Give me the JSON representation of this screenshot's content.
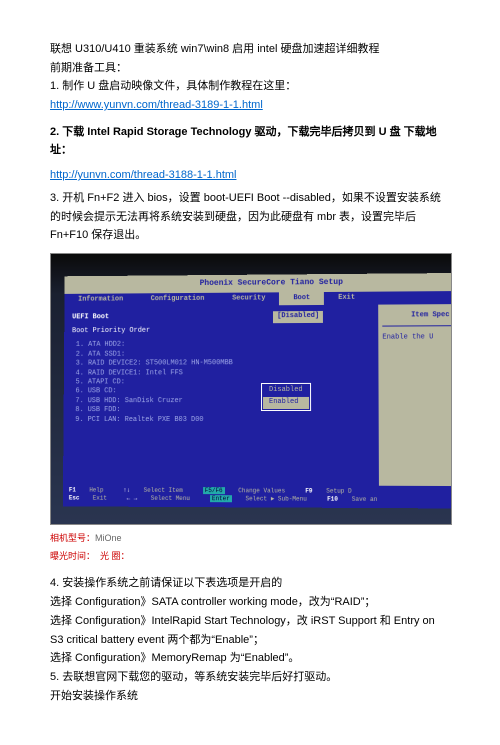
{
  "title": "联想 U310/U410 重装系统 win7\\win8 启用 intel 硬盘加速超详细教程",
  "prep_heading": "前期准备工具：",
  "step1": "1. 制作 U 盘启动映像文件，具体制作教程在这里：",
  "link1": "http://www.yunvn.com/thread-3189-1-1.html",
  "step2": "2. 下载 Intel Rapid Storage Technology  驱动，下载完毕后拷贝到 U 盘  下载地址：",
  "link2": "http://yunvn.com/thread-3188-1-1.html",
  "step3": "3. 开机 Fn+F2 进入 bios，设置 boot-UEFI Boot --disabled，如果不设置安装系统的时候会提示无法再将系统安装到硬盘，因为此硬盘有 mbr 表，设置完毕后 Fn+F10 保存退出。",
  "bios": {
    "header": "Phoenix SecureCore Tiano Setup",
    "menu": [
      "Information",
      "Configuration",
      "Security",
      "Boot",
      "Exit"
    ],
    "active_menu": "Boot",
    "uefi_label": "UEFI Boot",
    "uefi_value": "[Disabled]",
    "priority_label": "Boot Priority Order",
    "items": [
      "1. ATA HDD2:",
      "2. ATA SSD1:",
      "3. RAID DEVICE2: ST500LM012 HN-M500MBB",
      "4. RAID DEVICE1: Intel FFS",
      "5. ATAPI CD:",
      "6. USB CD:",
      "7. USB HDD: SanDisk Cruzer",
      "8. USB FDD:",
      "9. PCI LAN: Realtek PXE B03 D00"
    ],
    "popup": [
      "Disabled",
      "Enabled"
    ],
    "right_title": "Item Spec",
    "right_text": "Enable the U",
    "footer": {
      "f1": "F1",
      "f1t": "Help",
      "ud": "↑↓",
      "udt": "Select Item",
      "f56": "F5/F6",
      "f56t": "Change Values",
      "f9": "F9",
      "f9t": "Setup D",
      "esc": "Esc",
      "esct": "Exit",
      "lr": "← →",
      "lrt": "Select Menu",
      "ent": "Enter",
      "entt": "Select ► Sub-Menu",
      "f10": "F10",
      "f10t": "Save an"
    }
  },
  "meta_model_label": "相机型号：",
  "meta_model_value": "MiOne",
  "meta_exposure_label": "曝光时间：",
  "meta_aperture_label": "光  圈：",
  "step4_intro": "4. 安装操作系统之前请保证以下表选项是开启的",
  "step4_a": "选择 Configuration》SATA controller working mode，改为“RAID”；",
  "step4_b": "选择 Configuration》IntelRapid Start Technology，改 iRST Support 和 Entry on S3 critical battery event 两个都为“Enable”；",
  "step4_c": "选择 Configuration》MemoryRemap 为“Enabled”。",
  "step5": "5. 去联想官网下载您的驱动，等系统安装完毕后好打驱动。",
  "final": "开始安装操作系统"
}
